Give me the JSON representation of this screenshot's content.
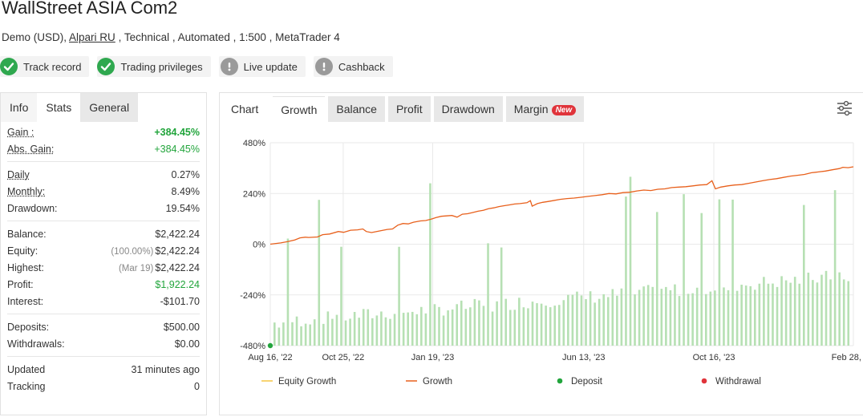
{
  "header": {
    "title": "WallStreet ASIA Com2",
    "subtitle_pre": "Demo (USD),",
    "broker": "Alpari RU",
    "subtitle_post": ", Technical , Automated , 1:500 , MetaTrader 4"
  },
  "badges": [
    {
      "label": "Track record",
      "status": "verified",
      "icon": "check-icon"
    },
    {
      "label": "Trading privileges",
      "status": "verified",
      "icon": "check-icon"
    },
    {
      "label": "Live update",
      "status": "unverified",
      "icon": "exclamation-icon"
    },
    {
      "label": "Cashback",
      "status": "unverified",
      "icon": "exclamation-icon"
    }
  ],
  "left_tabs": [
    "Info",
    "Stats",
    "General"
  ],
  "stats": {
    "gain": {
      "label": "Gain :",
      "value": "+384.45%"
    },
    "abs_gain": {
      "label": "Abs. Gain:",
      "value": "+384.45%"
    },
    "daily": {
      "label": "Daily",
      "value": "0.27%"
    },
    "monthly": {
      "label": "Monthly:",
      "value": "8.49%"
    },
    "drawdown": {
      "label": "Drawdown:",
      "value": "19.54%"
    },
    "balance": {
      "label": "Balance:",
      "value": "$2,422.24"
    },
    "equity": {
      "label": "Equity:",
      "sub": "(100.00%)",
      "value": "$2,422.24"
    },
    "highest": {
      "label": "Highest:",
      "sub": "(Mar 19)",
      "value": "$2,422.24"
    },
    "profit": {
      "label": "Profit:",
      "value": "$1,922.24"
    },
    "interest": {
      "label": "Interest:",
      "value": "-$101.70"
    },
    "deposits": {
      "label": "Deposits:",
      "value": "$500.00"
    },
    "withdrawals": {
      "label": "Withdrawals:",
      "value": "$0.00"
    },
    "updated": {
      "label": "Updated",
      "value": "31 minutes ago"
    },
    "tracking": {
      "label": "Tracking",
      "value": "0"
    }
  },
  "chart_tabs": {
    "label": "Chart",
    "items": [
      "Growth",
      "Balance",
      "Profit",
      "Drawdown",
      "Margin"
    ],
    "new_badge": "New"
  },
  "chart_data": {
    "type": "line",
    "y_ticks": [
      "480%",
      "240%",
      "0%",
      "-240%",
      "-480%"
    ],
    "ylim": [
      -480,
      480
    ],
    "x_ticks": [
      "Aug 16, '22",
      "Oct 25, '22",
      "Jan 19, '23",
      "Jun 13, '23",
      "Oct 16, '23",
      "Feb 28, '24"
    ],
    "legend": [
      {
        "name": "Equity Growth",
        "color": "#f5c542",
        "kind": "line"
      },
      {
        "name": "Growth",
        "color": "#e8601c",
        "kind": "line"
      },
      {
        "name": "Deposit",
        "color": "#22a53c",
        "kind": "dot"
      },
      {
        "name": "Withdrawal",
        "color": "#e0343b",
        "kind": "dot"
      }
    ],
    "growth_points": [
      [
        0,
        0
      ],
      [
        6,
        6
      ],
      [
        10,
        12
      ],
      [
        14,
        20
      ],
      [
        17,
        30
      ],
      [
        20,
        33
      ],
      [
        22,
        32
      ],
      [
        27,
        34
      ],
      [
        30,
        45
      ],
      [
        34,
        48
      ],
      [
        39,
        60
      ],
      [
        42,
        56
      ],
      [
        46,
        66
      ],
      [
        50,
        68
      ],
      [
        53,
        72
      ],
      [
        55,
        60
      ],
      [
        58,
        55
      ],
      [
        62,
        62
      ],
      [
        67,
        70
      ],
      [
        70,
        72
      ],
      [
        73,
        90
      ],
      [
        76,
        98
      ],
      [
        79,
        96
      ],
      [
        82,
        104
      ],
      [
        86,
        110
      ],
      [
        89,
        112
      ],
      [
        92,
        118
      ],
      [
        95,
        126
      ],
      [
        98,
        132
      ],
      [
        101,
        134
      ],
      [
        104,
        136
      ],
      [
        107,
        128
      ],
      [
        110,
        142
      ],
      [
        113,
        144
      ],
      [
        116,
        150
      ],
      [
        119,
        156
      ],
      [
        122,
        160
      ],
      [
        125,
        168
      ],
      [
        128,
        172
      ],
      [
        131,
        178
      ],
      [
        134,
        182
      ],
      [
        137,
        186
      ],
      [
        140,
        190
      ],
      [
        143,
        192
      ],
      [
        147,
        196
      ],
      [
        149,
        206
      ],
      [
        150,
        180
      ],
      [
        153,
        192
      ],
      [
        156,
        198
      ],
      [
        159,
        202
      ],
      [
        162,
        206
      ],
      [
        166,
        212
      ],
      [
        170,
        216
      ],
      [
        174,
        218
      ],
      [
        178,
        222
      ],
      [
        182,
        226
      ],
      [
        186,
        230
      ],
      [
        190,
        234
      ],
      [
        194,
        240
      ],
      [
        198,
        238
      ],
      [
        202,
        244
      ],
      [
        206,
        246
      ],
      [
        210,
        252
      ],
      [
        214,
        256
      ],
      [
        218,
        254
      ],
      [
        222,
        260
      ],
      [
        226,
        262
      ],
      [
        230,
        268
      ],
      [
        234,
        270
      ],
      [
        238,
        272
      ],
      [
        242,
        276
      ],
      [
        246,
        280
      ],
      [
        250,
        282
      ],
      [
        253,
        300
      ],
      [
        255,
        262
      ],
      [
        258,
        270
      ],
      [
        262,
        276
      ],
      [
        266,
        280
      ],
      [
        270,
        282
      ],
      [
        274,
        288
      ],
      [
        278,
        294
      ],
      [
        282,
        300
      ],
      [
        286,
        306
      ],
      [
        290,
        310
      ],
      [
        294,
        316
      ],
      [
        298,
        322
      ],
      [
        302,
        326
      ],
      [
        306,
        330
      ],
      [
        310,
        338
      ],
      [
        314,
        342
      ],
      [
        318,
        346
      ],
      [
        322,
        352
      ],
      [
        326,
        358
      ],
      [
        328,
        364
      ],
      [
        331,
        362
      ],
      [
        334,
        366
      ]
    ],
    "x_range": [
      0,
      334
    ],
    "tick_days": [
      0,
      70,
      156,
      301,
      426,
      560
    ],
    "deposits": [
      [
        0,
        0
      ]
    ],
    "bar_count": 130
  }
}
